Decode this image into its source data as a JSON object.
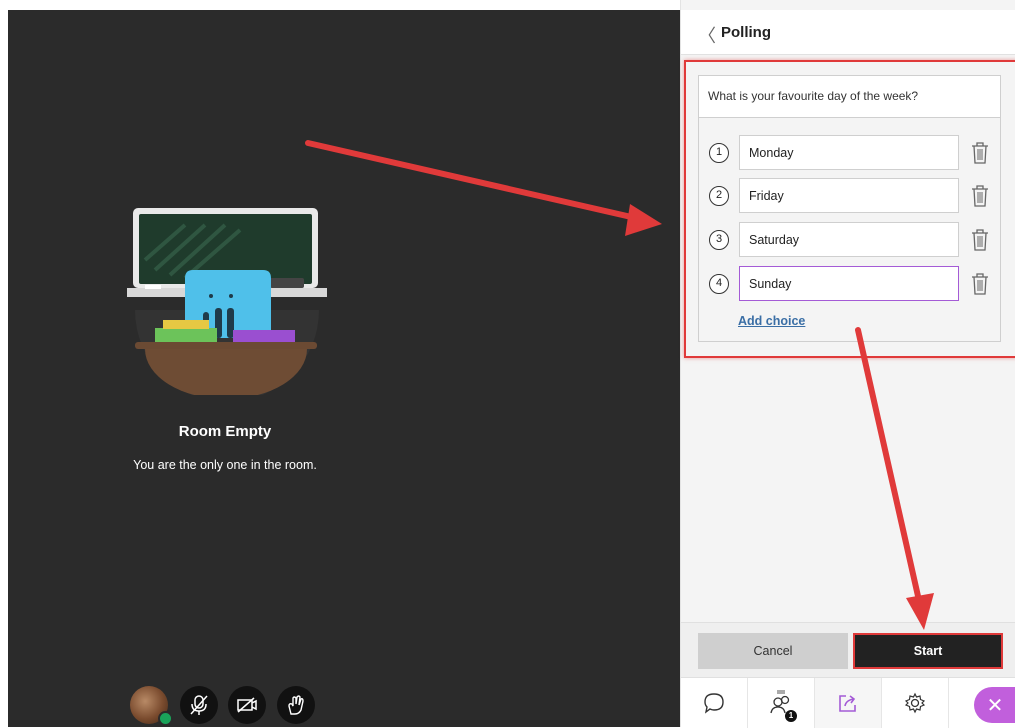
{
  "stage": {
    "room_title": "Room Empty",
    "room_subtitle": "You are the only one in the room."
  },
  "controls": {
    "icons": [
      "avatar",
      "microphone-muted-icon",
      "camera-off-icon",
      "hand-raise-icon"
    ]
  },
  "panel": {
    "title": "Polling",
    "question": "What is your favourite day of the week?",
    "choices": [
      {
        "number": "1",
        "value": "Monday"
      },
      {
        "number": "2",
        "value": "Friday"
      },
      {
        "number": "3",
        "value": "Saturday"
      },
      {
        "number": "4",
        "value": "Sunday"
      }
    ],
    "add_choice_label": "Add choice",
    "cancel_label": "Cancel",
    "start_label": "Start",
    "participants_count": "1"
  },
  "colors": {
    "stage_bg": "#2b2b2b",
    "highlight_red": "#e03a3a",
    "accent_purple": "#c15fdc",
    "link_blue": "#3a6ea5"
  }
}
